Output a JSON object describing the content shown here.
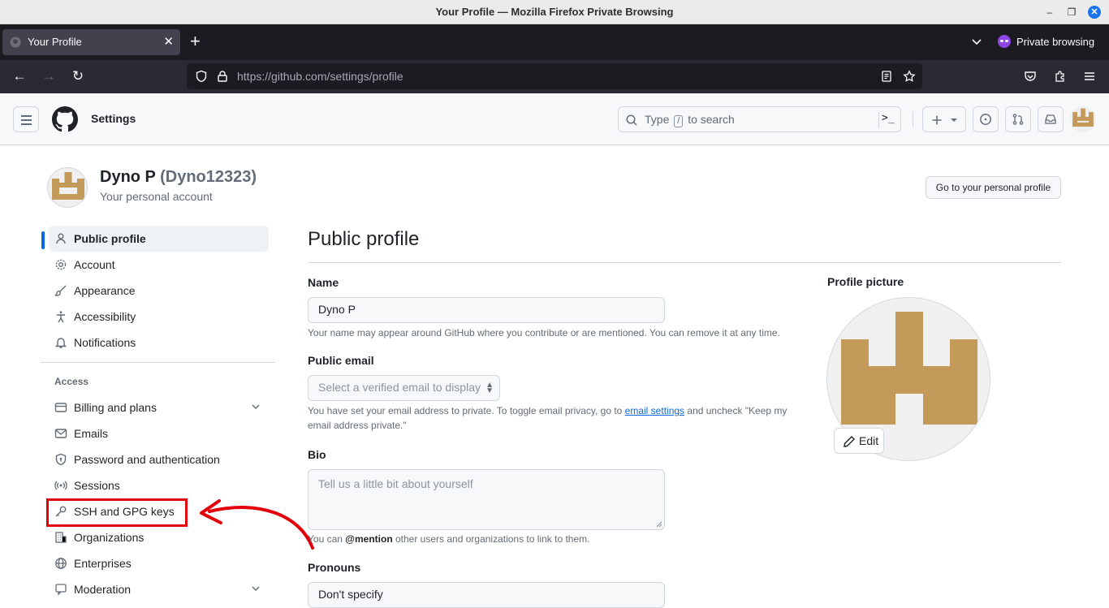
{
  "os": {
    "window_title": "Your Profile — Mozilla Firefox Private Browsing"
  },
  "browser": {
    "tab_title": "Your Profile",
    "private_label": "Private browsing",
    "url_host": "https://github.com",
    "url_path": "/settings/profile"
  },
  "github_header": {
    "section_title": "Settings",
    "search_prefix": "Type",
    "search_key": "/",
    "search_suffix": "to search",
    "command_glyph": ">_"
  },
  "account": {
    "display_name": "Dyno P",
    "login": "(Dyno12323)",
    "subtitle": "Your personal account",
    "go_profile_button": "Go to your personal profile"
  },
  "sidebar": {
    "items": [
      {
        "label": "Public profile"
      },
      {
        "label": "Account"
      },
      {
        "label": "Appearance"
      },
      {
        "label": "Accessibility"
      },
      {
        "label": "Notifications"
      }
    ],
    "access_heading": "Access",
    "access_items": [
      {
        "label": "Billing and plans"
      },
      {
        "label": "Emails"
      },
      {
        "label": "Password and authentication"
      },
      {
        "label": "Sessions"
      },
      {
        "label": "SSH and GPG keys"
      },
      {
        "label": "Organizations"
      },
      {
        "label": "Enterprises"
      },
      {
        "label": "Moderation"
      }
    ]
  },
  "main": {
    "title": "Public profile",
    "name_label": "Name",
    "name_value": "Dyno P",
    "name_hint": "Your name may appear around GitHub where you contribute or are mentioned. You can remove it at any time.",
    "email_label": "Public email",
    "email_placeholder": "Select a verified email to display",
    "email_hint_pre": "You have set your email address to private. To toggle email privacy, go to",
    "email_hint_link": "email settings",
    "email_hint_post": "and uncheck \"Keep my email address private.\"",
    "bio_label": "Bio",
    "bio_placeholder": "Tell us a little bit about yourself",
    "bio_hint_pre": "You can",
    "bio_hint_mention": "@mention",
    "bio_hint_post": "other users and organizations to link to them.",
    "pronouns_label": "Pronouns",
    "pronouns_value": "Don't specify",
    "picture_label": "Profile picture",
    "edit_button": "Edit"
  },
  "colors": {
    "avatar_gold": "#c49a5a",
    "accent_blue": "#0969da",
    "annotation_red": "#e3000b"
  }
}
